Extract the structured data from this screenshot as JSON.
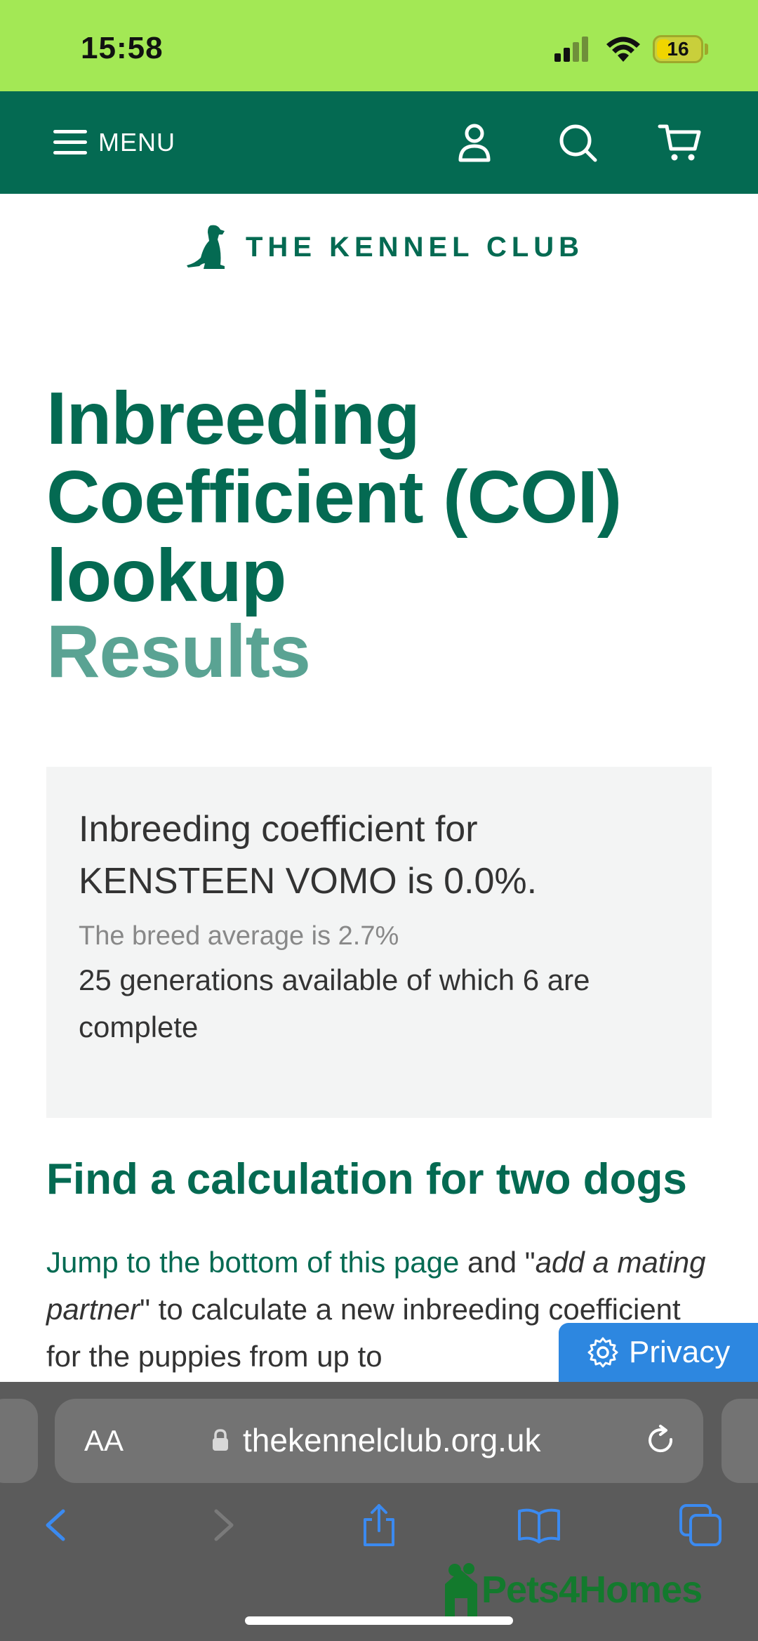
{
  "status_bar": {
    "time": "15:58",
    "battery": "16"
  },
  "nav": {
    "menu_label": "MENU",
    "icons": [
      "hamburger-icon",
      "user-icon",
      "search-icon",
      "cart-icon"
    ]
  },
  "logo": {
    "text": "THE KENNEL CLUB"
  },
  "page": {
    "title": "Inbreeding Coefficient (COI) lookup",
    "subtitle": "Results"
  },
  "result": {
    "main": "Inbreeding coefficient for KENSTEEN VOMO is 0.0%.",
    "breed_average": "The breed average is 2.7%",
    "generations": "25 generations available of which 6 are complete"
  },
  "section": {
    "heading": "Find a calculation for two dogs",
    "link": "Jump to the bottom of this page",
    "text_1": " and \"",
    "emphasis": "add a mating partner",
    "text_2": "\" to calculate a new inbreeding coefficient for the puppies from up to"
  },
  "privacy": {
    "label": "Privacy"
  },
  "browser": {
    "aa_label": "AA",
    "url": "thekennelclub.org.uk"
  },
  "watermark": {
    "text": "Pets4Homes"
  },
  "colors": {
    "brand_green": "#046a52",
    "light_green": "#5aa393",
    "status_bar": "#a3e855",
    "privacy_blue": "#2d87e0"
  }
}
